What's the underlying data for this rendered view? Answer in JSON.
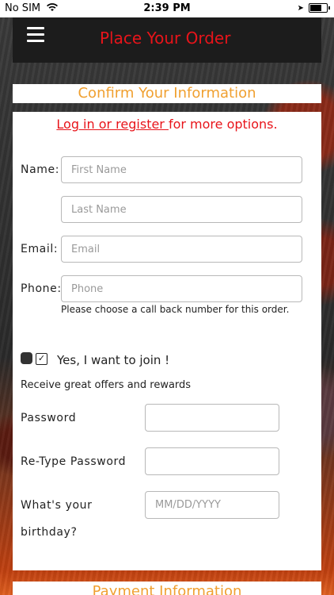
{
  "status_bar": {
    "carrier": "No SIM",
    "time": "2:39 PM"
  },
  "header": {
    "title": "Place Your Order"
  },
  "confirm_section": {
    "title": "Confirm Your Information",
    "login_link": "Log in or register ",
    "login_suffix": "for more options."
  },
  "form": {
    "name_label": "Name:",
    "first_name_placeholder": "First Name",
    "last_name_placeholder": "Last Name",
    "email_label": "Email:",
    "email_placeholder": "Email",
    "phone_label": "Phone:",
    "phone_placeholder": "Phone",
    "phone_help": "Please choose a call back number for this order.",
    "join_label": "Yes, I want to join !",
    "join_checked": true,
    "offers_text": "Receive great offers and rewards",
    "password_label": "Password",
    "retype_password_label": "Re-Type Password",
    "birthday_label_line1": "What's your",
    "birthday_label_line2": "birthday?",
    "birthday_placeholder": "MM/DD/YYYY"
  },
  "payment_section": {
    "title": "Payment Information"
  }
}
